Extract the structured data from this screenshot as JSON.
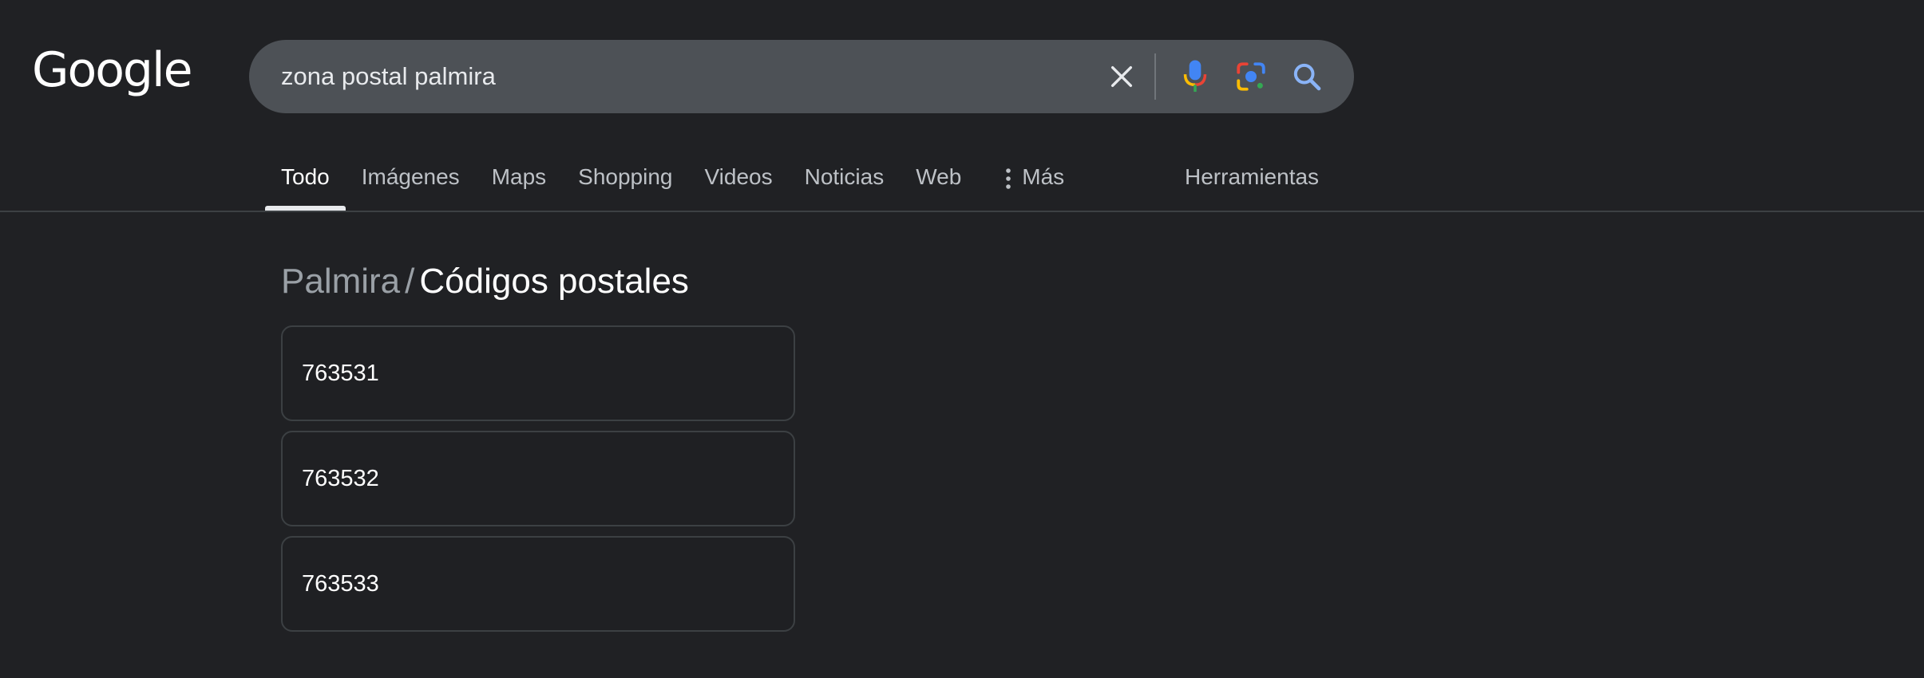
{
  "logo": {
    "text": "Google"
  },
  "search": {
    "query": "zona postal palmira",
    "icons": {
      "clear": "close-icon",
      "voice": "microphone-icon",
      "lens": "google-lens-icon",
      "submit": "search-icon"
    }
  },
  "tabs": [
    {
      "label": "Todo",
      "active": true
    },
    {
      "label": "Imágenes"
    },
    {
      "label": "Maps"
    },
    {
      "label": "Shopping"
    },
    {
      "label": "Videos"
    },
    {
      "label": "Noticias"
    },
    {
      "label": "Web"
    },
    {
      "label": "Más",
      "icon": "more-vert-icon"
    }
  ],
  "tools_label": "Herramientas",
  "result": {
    "city": "Palmira",
    "separator": "/",
    "title": "Códigos postales",
    "codes": [
      "763531",
      "763532",
      "763533"
    ]
  },
  "colors": {
    "background": "#202124",
    "search_box": "#4d5156",
    "card_border": "#3c4043",
    "text_primary": "#ffffff",
    "text_secondary": "#bdc1c6",
    "google_blue": "#4285f4",
    "google_red": "#ea4335",
    "google_yellow": "#fbbc04",
    "google_green": "#34a853",
    "search_icon": "#8ab4f8"
  }
}
